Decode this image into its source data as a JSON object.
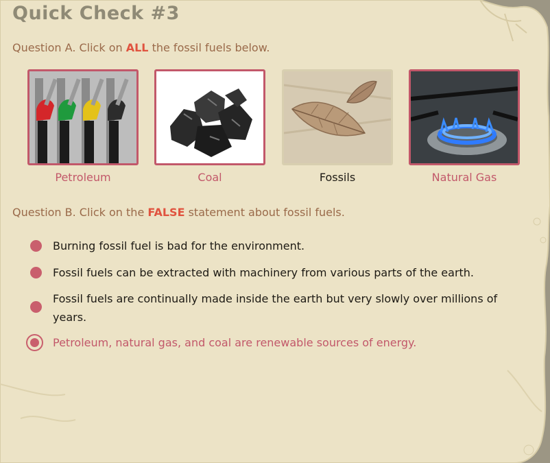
{
  "title": "Quick Check #3",
  "question_a": {
    "prefix": "Question A. Click on ",
    "highlight": "ALL",
    "suffix": " the fossil fuels below."
  },
  "fuels": [
    {
      "label": "Petroleum",
      "selected": true,
      "image": "gas-pump-nozzles"
    },
    {
      "label": "Coal",
      "selected": true,
      "image": "coal-lumps"
    },
    {
      "label": "Fossils",
      "selected": false,
      "image": "leaf-fossil"
    },
    {
      "label": "Natural Gas",
      "selected": true,
      "image": "gas-burner-flame"
    }
  ],
  "question_b": {
    "prefix": "Question B. Click on the ",
    "highlight": "FALSE",
    "suffix": " statement about fossil fuels."
  },
  "options": [
    {
      "text": "Burning fossil fuel is bad for the environment.",
      "selected": false
    },
    {
      "text": "Fossil fuels can be extracted with machinery from various parts of the earth.",
      "selected": false
    },
    {
      "text": "Fossil fuels are continually made inside the earth but very slowly over millions of years.",
      "selected": false
    },
    {
      "text": "Petroleum, natural gas, and coal are renewable sources of energy.",
      "selected": true
    }
  ],
  "colors": {
    "accent": "#c2586a",
    "highlight": "#e0533f",
    "parchment": "#ece3c6",
    "background": "#9c9684"
  }
}
